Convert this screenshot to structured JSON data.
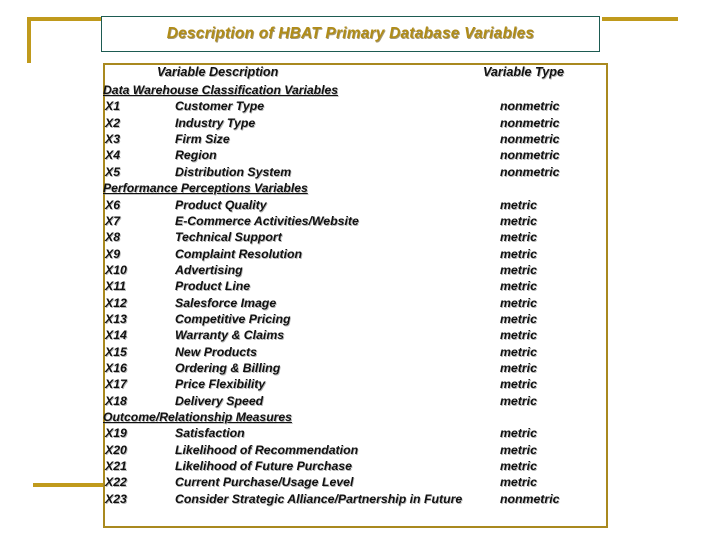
{
  "slide": {
    "title": "Description of  HBAT Primary Database Variables",
    "accent_gold": "#c09a1c",
    "title_border_color": "#1d5b52",
    "title_text_color": "#b08c18",
    "table_border_color": "#a9891f"
  },
  "table": {
    "headers": {
      "description": "Variable Description",
      "type": "Variable Type"
    },
    "sections": [
      {
        "heading": "Data Warehouse Classification Variables",
        "rows": [
          {
            "code": "X1",
            "description": "Customer Type",
            "type": "nonmetric"
          },
          {
            "code": "X2",
            "description": "Industry Type",
            "type": "nonmetric"
          },
          {
            "code": "X3",
            "description": "Firm Size",
            "type": "nonmetric"
          },
          {
            "code": "X4",
            "description": "Region",
            "type": "nonmetric"
          },
          {
            "code": "X5",
            "description": "Distribution System",
            "type": "nonmetric"
          }
        ]
      },
      {
        "heading": "Performance Perceptions Variables",
        "rows": [
          {
            "code": "X6",
            "description": "Product Quality",
            "type": "metric"
          },
          {
            "code": "X7",
            "description": "E-Commerce Activities/Website",
            "type": "metric"
          },
          {
            "code": "X8",
            "description": "Technical Support",
            "type": "metric"
          },
          {
            "code": "X9",
            "description": "Complaint Resolution",
            "type": "metric"
          },
          {
            "code": "X10",
            "description": "Advertising",
            "type": "metric"
          },
          {
            "code": "X11",
            "description": "Product Line",
            "type": "metric"
          },
          {
            "code": "X12",
            "description": "Salesforce Image",
            "type": "metric"
          },
          {
            "code": "X13",
            "description": "Competitive Pricing",
            "type": "metric"
          },
          {
            "code": "X14",
            "description": "Warranty & Claims",
            "type": "metric"
          },
          {
            "code": "X15",
            "description": "New Products",
            "type": "metric"
          },
          {
            "code": "X16",
            "description": "Ordering & Billing",
            "type": "metric"
          },
          {
            "code": "X17",
            "description": "Price Flexibility",
            "type": "metric"
          },
          {
            "code": "X18",
            "description": "Delivery Speed",
            "type": "metric"
          }
        ]
      },
      {
        "heading": "Outcome/Relationship Measures",
        "rows": [
          {
            "code": "X19",
            "description": "Satisfaction",
            "type": "metric"
          },
          {
            "code": "X20",
            "description": "Likelihood of Recommendation",
            "type": "metric"
          },
          {
            "code": "X21",
            "description": "Likelihood of Future Purchase",
            "type": "metric"
          },
          {
            "code": "X22",
            "description": "Current Purchase/Usage Level",
            "type": "metric"
          },
          {
            "code": "X23",
            "description": "Consider Strategic Alliance/Partnership in Future",
            "type": "nonmetric"
          }
        ]
      }
    ]
  }
}
